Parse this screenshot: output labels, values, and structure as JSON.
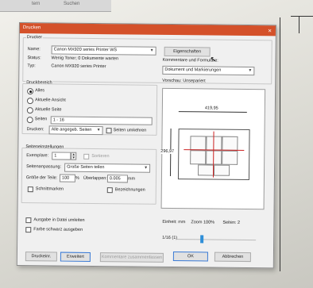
{
  "dialog": {
    "title": "Drucken",
    "close_glyph": "×"
  },
  "printer_group": {
    "title": "Drucker",
    "name_label": "Name:",
    "name_value": "Canon MX920 series Printer WS",
    "properties_button": "Eigenschaften",
    "status_label": "Status:",
    "status_value": "Wenig Toner; 0 Dokumente warten",
    "type_label": "Typ:",
    "type_value": "Canon MX920 series Printer"
  },
  "comments": {
    "label": "Kommentare und Formulare:",
    "value": "Dokument und Markierungen"
  },
  "range": {
    "title": "Druckbereich",
    "options": [
      "Alles",
      "Aktuelle Ansicht",
      "Aktuelle Seite",
      "Seiten"
    ],
    "selected_index": 0,
    "pages_value": "1 - 16",
    "print_label": "Drucken:",
    "print_value": "Alle angegeb. Seiten",
    "reverse_label": "Seiten umkehren"
  },
  "page_setup": {
    "title": "Seiteneinstellungen",
    "copies_label": "Exemplare:",
    "copies_value": "1",
    "collate_label": "Sortieren",
    "scaling_label": "Seitenanpassung:",
    "scaling_value": "Große Seiten teilen",
    "tile_scale_label": "Größe der Teile:",
    "tile_scale_value": "100",
    "tile_scale_unit": "%",
    "overlap_label": "Überlappen:",
    "overlap_value": "0.005",
    "overlap_unit": "mm",
    "cut_marks_label": "Schnittmarken",
    "labels_label": "Bezeichnungen"
  },
  "output": {
    "print_to_file": "Ausgabe in Datei umleiten",
    "color_as_black": "Farbe schwarz ausgeben"
  },
  "preview": {
    "title": "Vorschau: Unsepariert",
    "width_dim": "419,95",
    "height_dim": "296,97",
    "unit_label": "Einheit: mm",
    "zoom_label": "Zoom 100%",
    "pages_label": "Seiten: 2",
    "page_counter": "1/16 (1)"
  },
  "buttons": {
    "print_setup": "Druckeinr.",
    "advanced": "Erweitert",
    "summarize": "Kommentare zusammenfassen",
    "ok": "OK",
    "cancel": "Abbrechen"
  },
  "background": {
    "tab1": "tern",
    "tab2": "Suchen"
  },
  "colors": {
    "titlebar": "#d4512a",
    "default_border": "#3b7bd6",
    "slider": "#2f8fd8",
    "tile_line": "#cc2222"
  }
}
